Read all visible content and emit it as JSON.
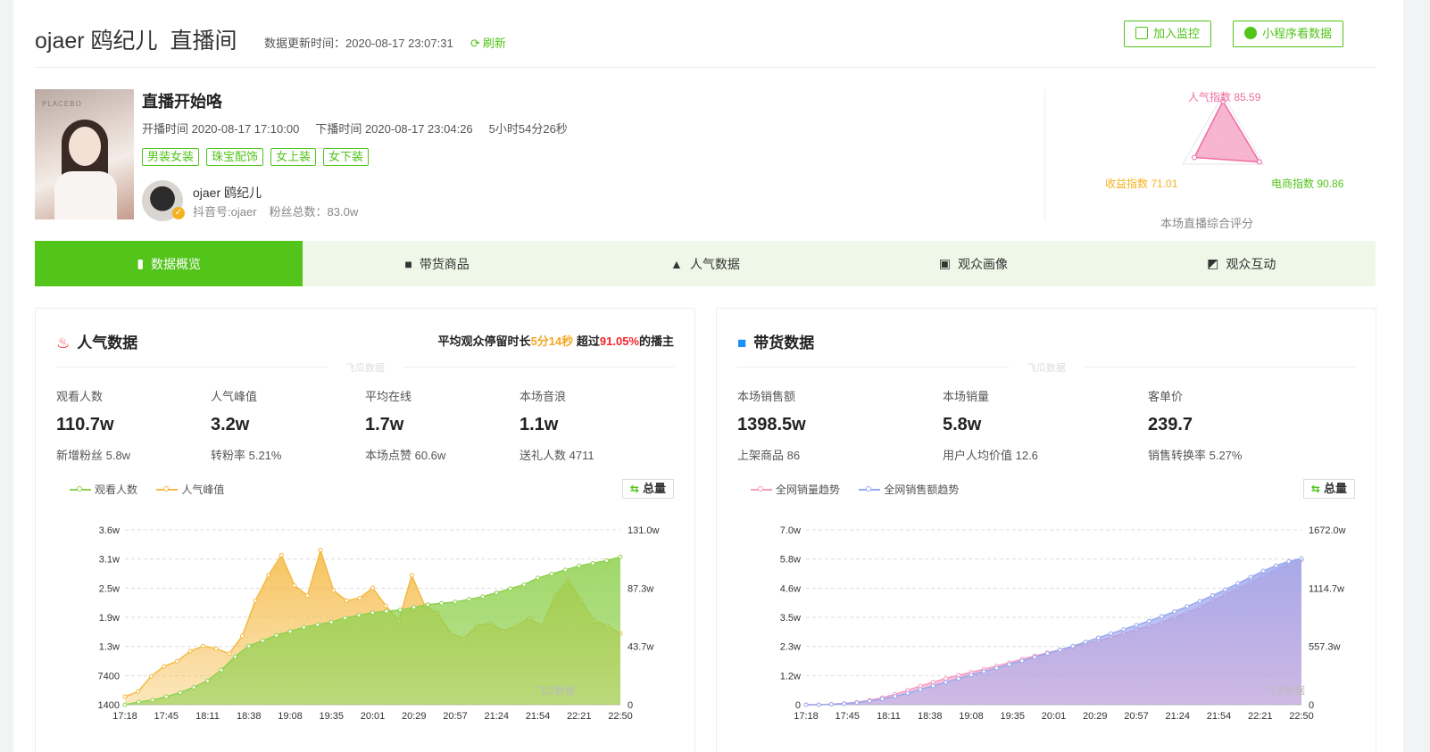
{
  "header": {
    "anchor": "ojaer 鸥纪儿",
    "room": "直播间",
    "update_label": "数据更新时间：2020-08-17 23:07:31",
    "refresh_label": "刷新",
    "monitor_button": "加入监控",
    "miniprogram_button": "小程序看数据"
  },
  "live": {
    "title": "直播开始咯",
    "start": "开播时间 2020-08-17 17:10:00",
    "end": "下播时间 2020-08-17 23:04:26",
    "duration": "5小时54分26秒",
    "tags": [
      "男装女装",
      "珠宝配饰",
      "女上装",
      "女下装"
    ],
    "anchor_name": "ojaer 鸥纪儿",
    "douyin_id": "抖音号:ojaer",
    "fans": "粉丝总数：83.0w"
  },
  "score": {
    "popularity": "人气指数 85.59",
    "income": "收益指数 71.01",
    "ecommerce": "电商指数 90.86",
    "caption": "本场直播综合评分",
    "values": {
      "popularity": 85.59,
      "income": 71.01,
      "ecommerce": 90.86
    }
  },
  "tabs": [
    {
      "label": "数据概览",
      "icon": "bar-chart-icon",
      "active": true
    },
    {
      "label": "带货商品",
      "icon": "shopping-bag-icon",
      "active": false
    },
    {
      "label": "人气数据",
      "icon": "fire-icon",
      "active": false
    },
    {
      "label": "观众画像",
      "icon": "portrait-icon",
      "active": false
    },
    {
      "label": "观众互动",
      "icon": "interaction-icon",
      "active": false
    }
  ],
  "popularity": {
    "title": "人气数据",
    "note_prefix": "平均观众停留时长",
    "note_time": "5分14秒",
    "note_mid": " 超过",
    "note_pct": "91.05%",
    "note_suffix": "的播主",
    "watermark": "飞瓜数据",
    "metrics": [
      {
        "label": "观看人数",
        "value": "110.7w",
        "sub": "新增粉丝 5.8w"
      },
      {
        "label": "人气峰值",
        "value": "3.2w",
        "sub": "转粉率 5.21%"
      },
      {
        "label": "平均在线",
        "value": "1.7w",
        "sub": "本场点赞 60.6w"
      },
      {
        "label": "本场音浪",
        "value": "1.1w",
        "sub": "送礼人数 4711"
      }
    ],
    "total_button": "总量"
  },
  "sales": {
    "title": "带货数据",
    "watermark": "飞瓜数据",
    "metrics": [
      {
        "label": "本场销售额",
        "value": "1398.5w",
        "sub": "上架商品 86"
      },
      {
        "label": "本场销量",
        "value": "5.8w",
        "sub": "用户人均价值 12.6"
      },
      {
        "label": "客单价",
        "value": "239.7",
        "sub": "销售转换率 5.27%"
      }
    ],
    "total_button": "总量"
  },
  "chart_watermark": "飞瓜数据",
  "chart_data": [
    {
      "type": "area",
      "x": [
        "17:18",
        "17:45",
        "18:11",
        "18:38",
        "19:08",
        "19:35",
        "20:01",
        "20:29",
        "20:57",
        "21:24",
        "21:54",
        "22:21",
        "22:50"
      ],
      "y_left_ticks": [
        "1400",
        "7400",
        "1.3w",
        "1.9w",
        "2.5w",
        "3.1w",
        "3.6w"
      ],
      "y_right_ticks": [
        "0",
        "43.7w",
        "87.3w",
        "131.0w"
      ],
      "y_left_range": [
        1400,
        36000
      ],
      "y_right_range": [
        0,
        131
      ],
      "series": [
        {
          "name": "观看人数",
          "axis": "right",
          "color": "#8fd14f",
          "values": [
            0,
            2,
            3.5,
            6,
            9,
            13,
            18,
            26,
            36,
            44,
            48,
            52,
            55,
            58,
            60,
            62,
            65,
            67,
            69,
            70,
            71,
            73,
            75,
            76,
            77,
            79,
            81,
            84,
            87,
            90,
            95,
            98,
            101,
            104,
            106,
            108,
            110.7
          ]
        },
        {
          "name": "人气峰值",
          "axis": "left",
          "color": "#f5b942",
          "values": [
            3000,
            4000,
            7000,
            9000,
            10000,
            12000,
            13000,
            12500,
            11500,
            15000,
            22000,
            27000,
            31000,
            25000,
            23000,
            32000,
            24000,
            22000,
            22500,
            24500,
            21000,
            18000,
            27000,
            21000,
            19500,
            15500,
            14500,
            17000,
            17500,
            16000,
            17000,
            18500,
            17000,
            23000,
            26000,
            22000,
            18000,
            17000,
            15500
          ]
        }
      ]
    },
    {
      "type": "area",
      "x": [
        "17:18",
        "17:45",
        "18:11",
        "18:38",
        "19:08",
        "19:35",
        "20:01",
        "20:29",
        "20:57",
        "21:24",
        "21:54",
        "22:21",
        "22:50"
      ],
      "y_left_ticks": [
        "0",
        "1.2w",
        "2.3w",
        "3.5w",
        "4.6w",
        "5.8w",
        "7.0w"
      ],
      "y_right_ticks": [
        "0",
        "557.3w",
        "1114.7w",
        "1672.0w"
      ],
      "y_left_range": [
        0,
        70000
      ],
      "y_right_range": [
        0,
        1672
      ],
      "series": [
        {
          "name": "全网销量趋势",
          "axis": "left",
          "color": "#f59ac0",
          "values": [
            0,
            0,
            200,
            500,
            1000,
            1800,
            2800,
            4200,
            5800,
            7500,
            9000,
            10500,
            11800,
            13000,
            14200,
            15500,
            16800,
            18200,
            19500,
            20800,
            22000,
            23200,
            24400,
            25600,
            27000,
            28500,
            30000,
            31500,
            33000,
            35000,
            37000,
            39000,
            41500,
            44000,
            46500,
            49000,
            51500,
            54000,
            56500,
            58000
          ]
        },
        {
          "name": "全网销售额趋势",
          "axis": "right",
          "color": "#9aa8ee",
          "values": [
            0,
            0,
            4,
            10,
            20,
            35,
            55,
            80,
            110,
            145,
            180,
            215,
            250,
            285,
            318,
            350,
            385,
            420,
            455,
            490,
            525,
            560,
            600,
            640,
            680,
            720,
            760,
            800,
            845,
            890,
            940,
            990,
            1045,
            1100,
            1160,
            1220,
            1280,
            1330,
            1370,
            1398.5
          ]
        }
      ]
    }
  ]
}
